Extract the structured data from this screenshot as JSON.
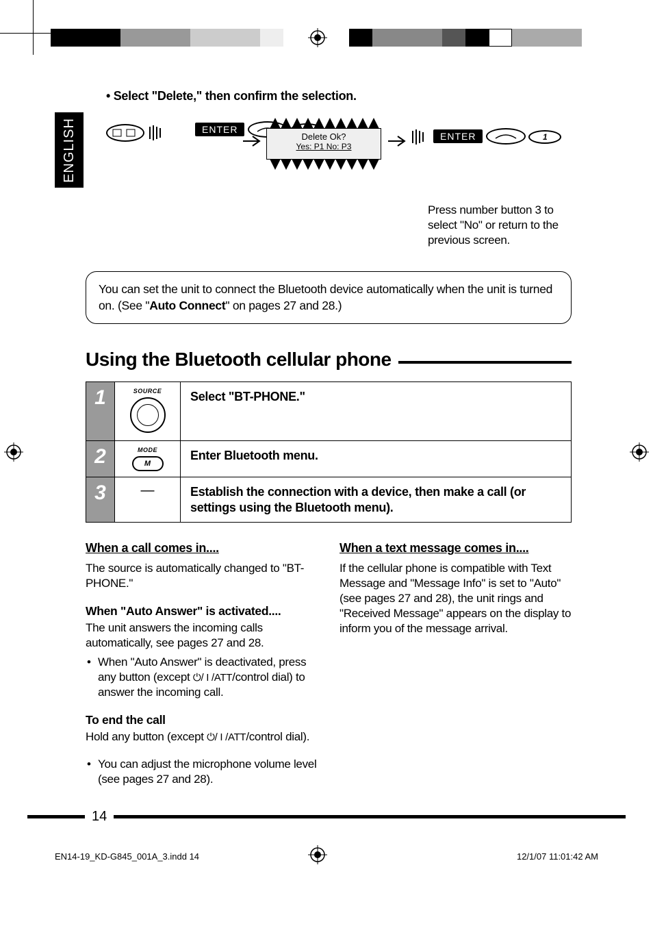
{
  "language_tab": "ENGLISH",
  "top_bullet": "Select \"Delete,\" then confirm the selection.",
  "diagram": {
    "enter_label": "ENTER",
    "lcd_line1": "Delete Ok?",
    "lcd_line2": "Yes: P1    No: P3",
    "note": "Press number button 3 to select \"No\" or return to the previous screen."
  },
  "info_box": {
    "pre": "You can set the unit to connect the Bluetooth device automatically when the unit is turned on. (See \"",
    "bold": "Auto Connect",
    "post": "\" on pages 27 and 28.)"
  },
  "section_title": "Using the Bluetooth cellular phone",
  "steps": [
    {
      "num": "1",
      "icon_label": "SOURCE",
      "icon_type": "dial",
      "desc": "Select \"BT-PHONE.\""
    },
    {
      "num": "2",
      "icon_label": "MODE",
      "icon_type": "mode",
      "icon_letter": "M",
      "desc": "Enter Bluetooth menu."
    },
    {
      "num": "3",
      "icon_label": "",
      "icon_type": "dash",
      "desc": "Establish the connection with a device, then make a call (or settings using the Bluetooth menu)."
    }
  ],
  "left_col": {
    "h1": "When a call comes in....",
    "p1": "The source is automatically changed to \"BT-PHONE.\"",
    "h2": "When \"Auto Answer\" is activated....",
    "p2": "The unit answers the incoming calls automatically, see pages 27 and 28.",
    "li1_pre": "When \"Auto Answer\" is deactivated, press any button (except ",
    "li1_glyph": "⏻/ I /ATT",
    "li1_post": "/control dial) to answer the incoming call.",
    "h3": "To end the call",
    "p3_pre": "Hold any button (except ",
    "p3_glyph": "⏻/ I /ATT",
    "p3_post": "/control dial).",
    "li2": "You can adjust the microphone volume level (see pages 27 and 28)."
  },
  "right_col": {
    "h1": "When a text message comes in....",
    "p1": "If the cellular phone is compatible with Text Message and \"Message Info\" is set to \"Auto\" (see pages 27 and 28), the unit rings and \"Received Message\" appears on the display to inform you of the message arrival."
  },
  "page_number": "14",
  "footer": {
    "left": "EN14-19_KD-G845_001A_3.indd   14",
    "right": "12/1/07   11:01:42 AM"
  }
}
